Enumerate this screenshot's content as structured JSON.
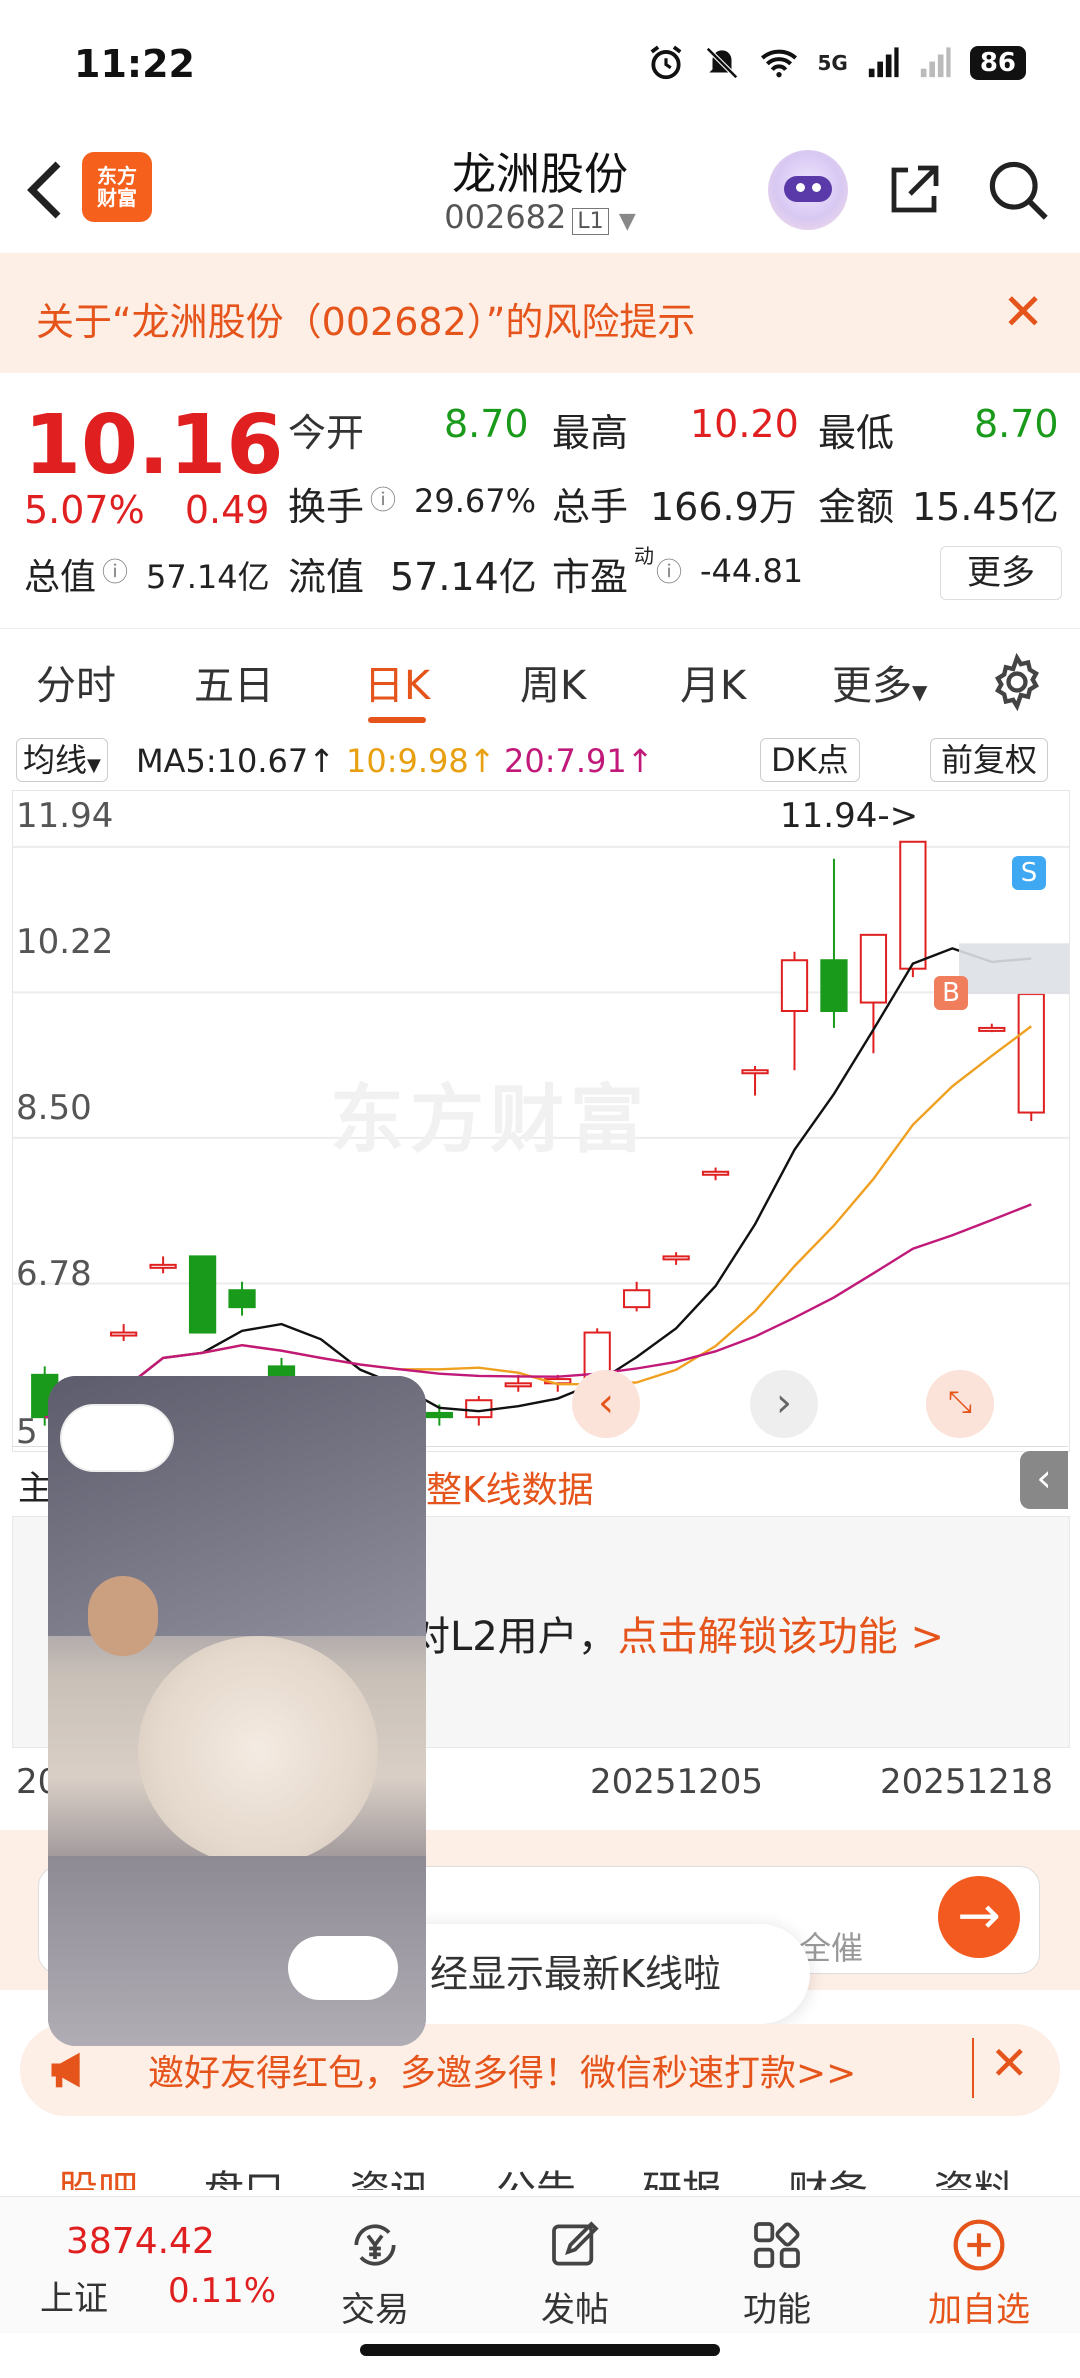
{
  "status_bar": {
    "time": "11:22",
    "network": "5G",
    "battery": "86"
  },
  "header": {
    "title": "龙洲股份",
    "code": "002682",
    "level": "L1",
    "logo_line1": "东方",
    "logo_line2": "财富"
  },
  "risk_banner": {
    "text": "关于“龙洲股份（002682）”的风险提示"
  },
  "quote": {
    "price": "10.16",
    "change_pct": "5.07%",
    "change": "0.49",
    "open_label": "今开",
    "open": "8.70",
    "high_label": "最高",
    "high": "10.20",
    "low_label": "最低",
    "low": "8.70",
    "turnover_label": "换手",
    "turnover": "29.67%",
    "volume_label": "总手",
    "volume": "166.9万",
    "amount_label": "金额",
    "amount": "15.45亿",
    "mktcap_label": "总值",
    "mktcap": "57.14亿",
    "float_label": "流值",
    "float": "57.14亿",
    "pe_label": "市盈",
    "pe_sup": "动",
    "pe": "-44.81",
    "more": "更多"
  },
  "tabs": [
    "分时",
    "五日",
    "日K",
    "周K",
    "月K",
    "更多"
  ],
  "ma_bar": {
    "selector": "均线",
    "ma5": "MA5:10.67",
    "ma10": "10:9.98",
    "ma20": "20:7.91",
    "dk": "DK点",
    "adjust": "前复权"
  },
  "chart_data": {
    "type": "candlestick",
    "y_ticks": [
      "11.94",
      "10.22",
      "8.50",
      "6.78"
    ],
    "y_tick_partial": "5",
    "max_annotation": "11.94->",
    "buy_marker": "B",
    "sell_marker": "S",
    "x_ticks": [
      "20251205",
      "20251218"
    ],
    "x_tick_partial": "20",
    "colors": {
      "up": "#e02020",
      "down": "#1a9a1a",
      "ma5": "#111111",
      "ma10": "#f0a020",
      "ma20": "#c0197a"
    }
  },
  "chart_overlay": {
    "toggle_label": "主",
    "toggle_text": "整K线数据",
    "lock_text": "对L2用户，",
    "lock_link": "点击解锁该功能 >"
  },
  "comment": {
    "placeholder_partial": "全催"
  },
  "toast": {
    "text": "经显示最新K线啦"
  },
  "promo": {
    "text": "邀好友得红包，多邀多得！微信秒速打款>>"
  },
  "bottom_tabs": [
    "股吧",
    "盘口",
    "资讯",
    "公告",
    "研报",
    "财务",
    "资料"
  ],
  "dock": {
    "index_value": "3874.42",
    "index_name": "上证",
    "index_change": "0.11%",
    "trade": "交易",
    "post": "发帖",
    "functions": "功能",
    "add_watch": "加自选"
  }
}
